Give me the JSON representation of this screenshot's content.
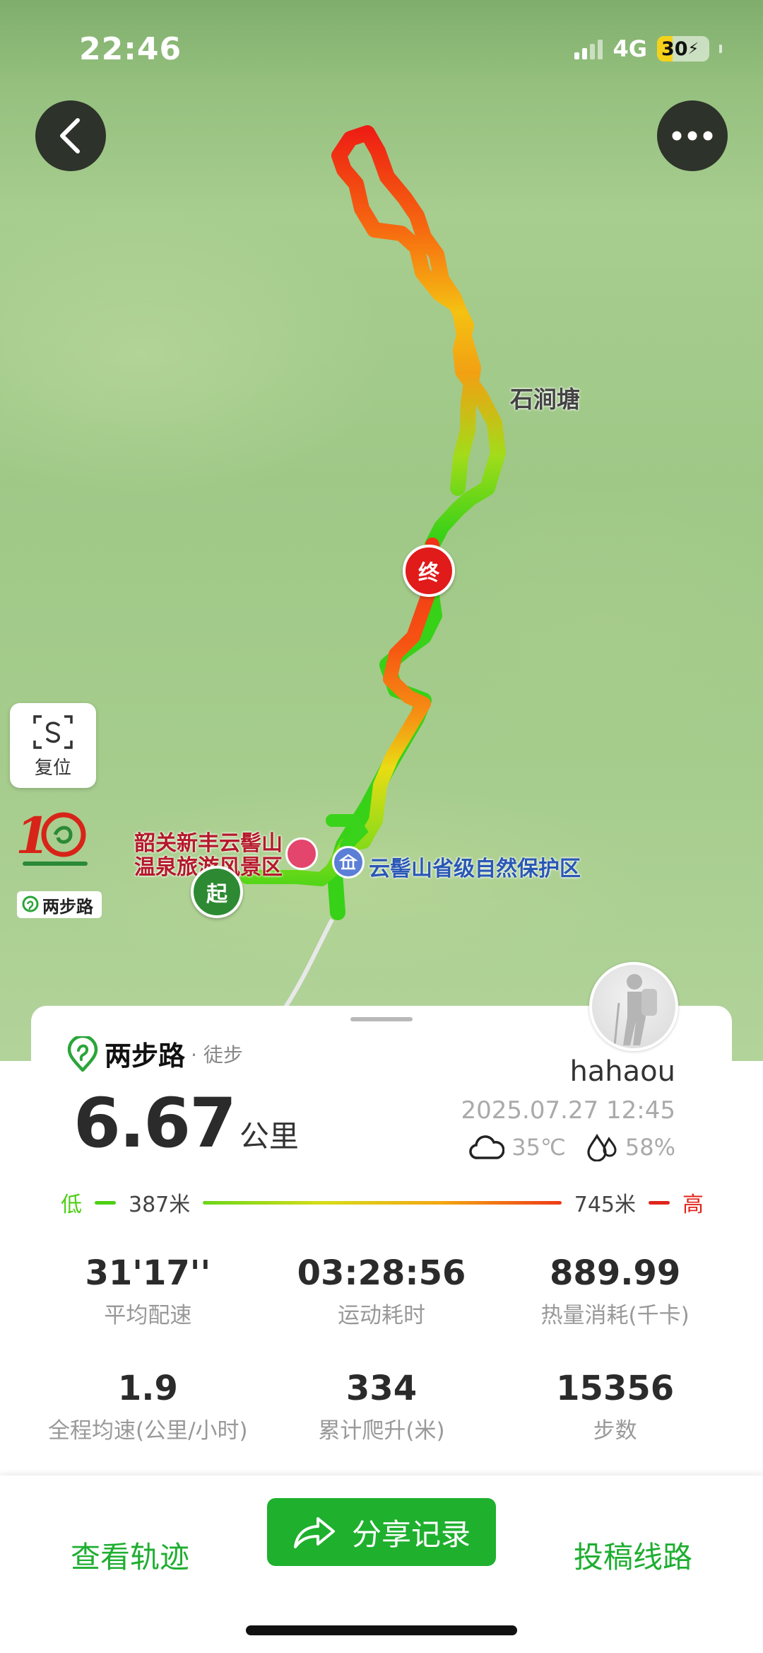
{
  "status_bar": {
    "time": "22:46",
    "network": "4G",
    "battery": "30"
  },
  "map": {
    "labels": {
      "village": "石涧塘",
      "spa_line1": "韶关新丰云髻山",
      "spa_line2": "温泉旅游风景区",
      "reserve": "云髻山省级自然保护区"
    },
    "markers": {
      "start": "起",
      "end": "终"
    },
    "reset_label": "复位",
    "brand_small": "两步路"
  },
  "card": {
    "brand": "两步路",
    "activity_type": "· 徒步",
    "username": "hahaou",
    "datetime": "2025.07.27 12:45",
    "temperature": "35℃",
    "humidity": "58%",
    "distance_value": "6.67",
    "distance_unit": "公里",
    "elevation": {
      "low_label": "低",
      "low_value": "387米",
      "high_value": "745米",
      "high_label": "高"
    },
    "stats": [
      {
        "value": "31'17''",
        "label": "平均配速"
      },
      {
        "value": "03:28:56",
        "label": "运动耗时"
      },
      {
        "value": "889.99",
        "label": "热量消耗(千卡)"
      },
      {
        "value": "1.9",
        "label": "全程均速(公里/小时)"
      },
      {
        "value": "334",
        "label": "累计爬升(米)"
      },
      {
        "value": "15356",
        "label": "步数"
      }
    ]
  },
  "bottom_bar": {
    "view_track": "查看轨迹",
    "share": "分享记录",
    "submit_route": "投稿线路"
  },
  "colors": {
    "accent_green": "#1fb02e",
    "track_low": "#4fcf16",
    "track_high": "#e0251c"
  }
}
